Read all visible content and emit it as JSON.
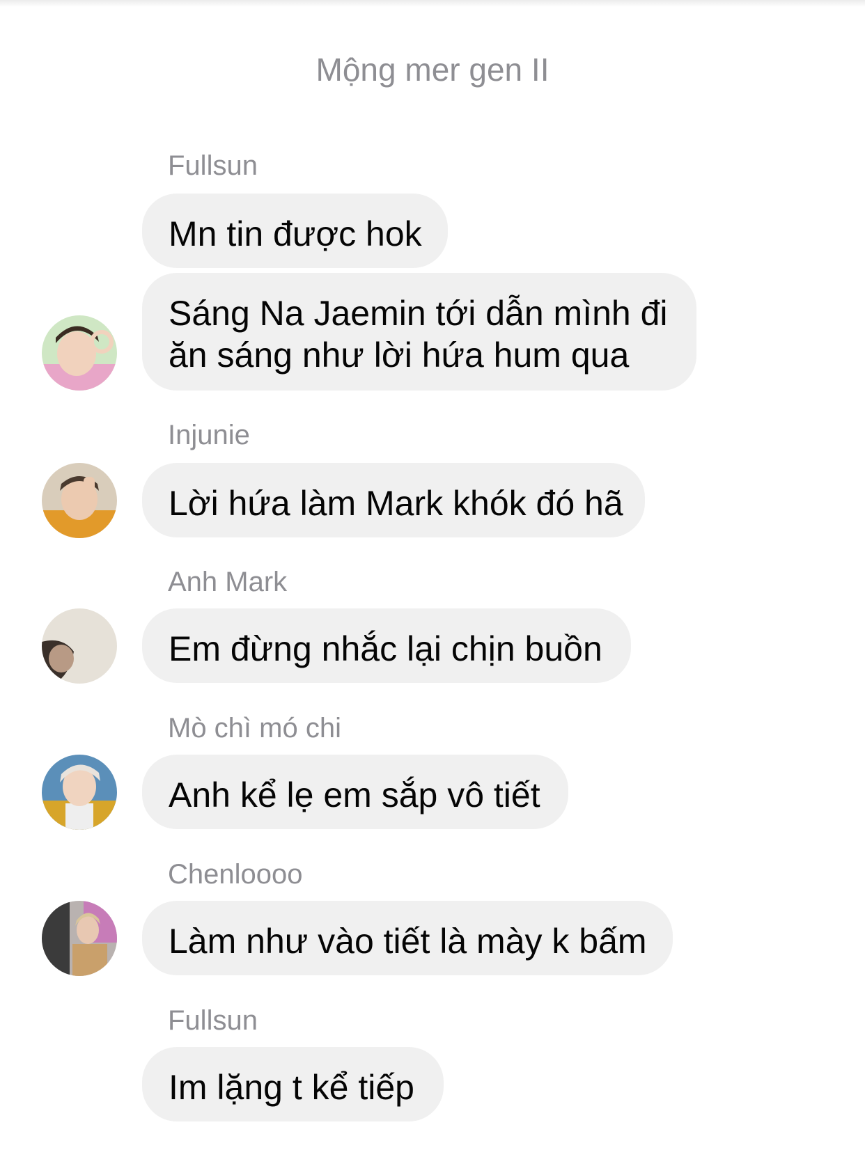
{
  "header": {
    "title": "Mộng mer gen II"
  },
  "messages": [
    {
      "sender": "Fullsun",
      "text": "Mn tin được hok"
    },
    {
      "text_line1": "Sáng Na Jaemin tới dẫn mình đi",
      "text_line2": "ăn sáng như lời hứa hum qua",
      "avatar": "avatar-pink-bg"
    },
    {
      "sender": "Injunie",
      "text": "Lời hứa làm Mark khók đó hã",
      "avatar": "avatar-orange-shirt"
    },
    {
      "sender": "Anh Mark",
      "text": "Em đừng nhắc lại chịn buồn",
      "avatar": "avatar-dim-room"
    },
    {
      "sender": "Mò chì mó chi",
      "text": "Anh kể lẹ em sắp vô tiết",
      "avatar": "avatar-yellow-jacket"
    },
    {
      "sender": "Chenloooo",
      "text": "Làm như vào tiết là mày k bấm",
      "avatar": "avatar-floral-shirt"
    },
    {
      "sender": "Fullsun",
      "text": "Im lặng t kể tiếp"
    }
  ],
  "colors": {
    "bubble": "#f0f0f0",
    "secondary_text": "#8e8e93",
    "primary_text": "#050505"
  }
}
